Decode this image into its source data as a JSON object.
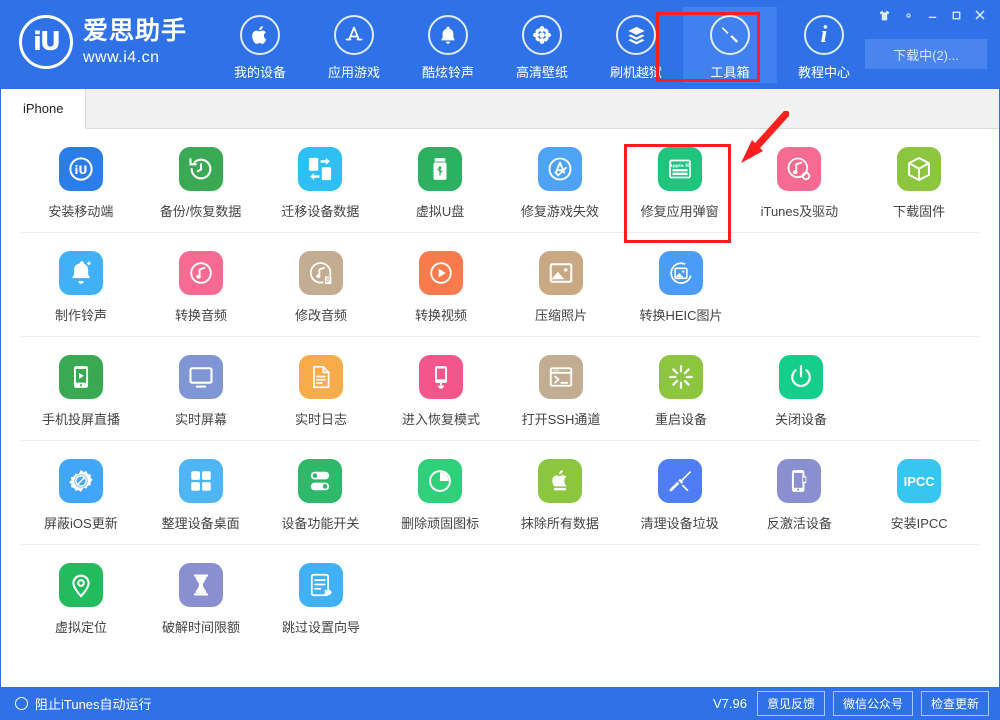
{
  "window": {
    "brand_name": "爱思助手",
    "brand_url": "www.i4.cn",
    "brand_logo_text": "iU",
    "controls": [
      {
        "name": "skin-icon",
        "label": "皮肤"
      },
      {
        "name": "settings-gear-icon",
        "label": "设置"
      },
      {
        "name": "minimize-icon",
        "label": "最小化"
      },
      {
        "name": "maximize-icon",
        "label": "最大化"
      },
      {
        "name": "close-icon",
        "label": "关闭"
      }
    ],
    "download_button": "下载中(2)..."
  },
  "nav": {
    "items": [
      {
        "label": "我的设备",
        "icon": "apple-icon",
        "active": false
      },
      {
        "label": "应用游戏",
        "icon": "appstore-icon",
        "active": false
      },
      {
        "label": "酷炫铃声",
        "icon": "bell-icon",
        "active": false
      },
      {
        "label": "高清壁纸",
        "icon": "flower-icon",
        "active": false
      },
      {
        "label": "刷机越狱",
        "icon": "box-stack-icon",
        "active": false
      },
      {
        "label": "工具箱",
        "icon": "tools-icon",
        "active": true
      },
      {
        "label": "教程中心",
        "icon": "info-icon",
        "active": false
      }
    ]
  },
  "tabs": [
    {
      "label": "iPhone",
      "active": true
    }
  ],
  "tool_rows": [
    [
      {
        "label": "安装移动端",
        "icon": "i4-app-icon",
        "color": "#2b7de9"
      },
      {
        "label": "备份/恢复数据",
        "icon": "restore-clock-icon",
        "color": "#3aa953"
      },
      {
        "label": "迁移设备数据",
        "icon": "device-transfer-icon",
        "color": "#2ec0f3"
      },
      {
        "label": "虚拟U盘",
        "icon": "usb-drive-icon",
        "color": "#2bb15f"
      },
      {
        "label": "修复游戏失效",
        "icon": "appstore-check-icon",
        "color": "#4fa3f7"
      },
      {
        "label": "修复应用弹窗",
        "icon": "apple-id-card-icon",
        "color": "#1fc47d"
      },
      {
        "label": "iTunes及驱动",
        "icon": "itunes-gear-icon",
        "color": "#f76b93"
      },
      {
        "label": "下载固件",
        "icon": "cube-icon",
        "color": "#8cc63f"
      }
    ],
    [
      {
        "label": "制作铃声",
        "icon": "bell-plus-icon",
        "color": "#41b1f5"
      },
      {
        "label": "转换音频",
        "icon": "music-note-icon",
        "color": "#f76b93"
      },
      {
        "label": "修改音频",
        "icon": "music-edit-icon",
        "color": "#c2ad93"
      },
      {
        "label": "转换视频",
        "icon": "play-circle-icon",
        "color": "#f97a4d"
      },
      {
        "label": "压缩照片",
        "icon": "photo-icon",
        "color": "#c9a884"
      },
      {
        "label": "转换HEIC图片",
        "icon": "photo-convert-icon",
        "color": "#4a9cf6"
      }
    ],
    [
      {
        "label": "手机投屏直播",
        "icon": "phone-broadcast-icon",
        "color": "#3aa953"
      },
      {
        "label": "实时屏幕",
        "icon": "monitor-icon",
        "color": "#7f95d4"
      },
      {
        "label": "实时日志",
        "icon": "document-lines-icon",
        "color": "#f7ab4a"
      },
      {
        "label": "进入恢复模式",
        "icon": "phone-recovery-icon",
        "color": "#f4558a"
      },
      {
        "label": "打开SSH通道",
        "icon": "terminal-icon",
        "color": "#c2ad93"
      },
      {
        "label": "重启设备",
        "icon": "restart-burst-icon",
        "color": "#8cc63f"
      },
      {
        "label": "关闭设备",
        "icon": "power-icon",
        "color": "#14ce8c"
      }
    ],
    [
      {
        "label": "屏蔽iOS更新",
        "icon": "block-update-gear-icon",
        "color": "#41a6f7"
      },
      {
        "label": "整理设备桌面",
        "icon": "grid-squares-icon",
        "color": "#4fb5f5"
      },
      {
        "label": "设备功能开关",
        "icon": "toggles-icon",
        "color": "#2eb86a"
      },
      {
        "label": "删除顽固图标",
        "icon": "pie-clock-icon",
        "color": "#2ed07a"
      },
      {
        "label": "抹除所有数据",
        "icon": "apple-erase-icon",
        "color": "#8cc63f"
      },
      {
        "label": "清理设备垃圾",
        "icon": "broom-icon",
        "color": "#4f7df5"
      },
      {
        "label": "反激活设备",
        "icon": "deactivate-phone-icon",
        "color": "#8a8fd0"
      },
      {
        "label": "安装IPCC",
        "icon": "ipcc-icon",
        "color": "#37c6f0",
        "text": "IPCC"
      }
    ],
    [
      {
        "label": "虚拟定位",
        "icon": "location-pin-icon",
        "color": "#22bb5e"
      },
      {
        "label": "破解时间限额",
        "icon": "hourglass-icon",
        "color": "#8a8fd0"
      },
      {
        "label": "跳过设置向导",
        "icon": "skip-wizard-icon",
        "color": "#41b1f5"
      }
    ]
  ],
  "footer": {
    "block_itunes_label": "阻止iTunes自动运行",
    "version": "V7.96",
    "buttons": [
      "意见反馈",
      "微信公众号",
      "检查更新"
    ]
  },
  "annotations": {
    "highlight_color": "#fc1f1f",
    "highlighted_nav": "工具箱",
    "highlighted_tool": "修复应用弹窗"
  }
}
